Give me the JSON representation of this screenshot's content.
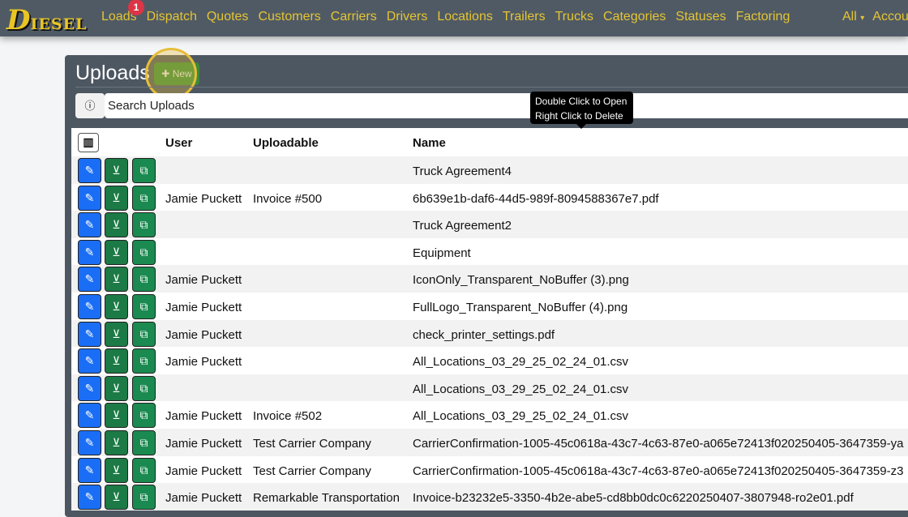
{
  "nav": {
    "logo": "DIESEL",
    "links": [
      "Loads",
      "Dispatch",
      "Quotes",
      "Customers",
      "Carriers",
      "Drivers",
      "Locations",
      "Trailers",
      "Trucks",
      "Categories",
      "Statuses",
      "Factoring"
    ],
    "loads_badge": "1",
    "filter": "All",
    "account": "Account"
  },
  "page": {
    "title": "Uploads",
    "new_label": "New",
    "search_value": "Search Uploads",
    "tooltip_line1": "Double Click to Open",
    "tooltip_line2": "Right Click to Delete"
  },
  "table": {
    "headers": [
      "User",
      "Uploadable",
      "Name"
    ],
    "rows": [
      [
        "",
        "",
        "Truck Agreement4"
      ],
      [
        "Jamie Puckett",
        "Invoice #500",
        "6b639e1b-daf6-44d5-989f-8094588367e7.pdf"
      ],
      [
        "",
        "",
        "Truck Agreement2"
      ],
      [
        "",
        "",
        "Equipment"
      ],
      [
        "Jamie Puckett",
        "",
        "IconOnly_Transparent_NoBuffer (3).png"
      ],
      [
        "Jamie Puckett",
        "",
        "FullLogo_Transparent_NoBuffer (4).png"
      ],
      [
        "Jamie Puckett",
        "",
        "check_printer_settings.pdf"
      ],
      [
        "Jamie Puckett",
        "",
        "All_Locations_03_29_25_02_24_01.csv"
      ],
      [
        "",
        "",
        "All_Locations_03_29_25_02_24_01.csv"
      ],
      [
        "Jamie Puckett",
        "Invoice #502",
        "All_Locations_03_29_25_02_24_01.csv"
      ],
      [
        "Jamie Puckett",
        "Test Carrier Company",
        "CarrierConfirmation-1005-45c0618a-43c7-4c63-87e0-a065e72413f020250405-3647359-ya"
      ],
      [
        "Jamie Puckett",
        "Test Carrier Company",
        "CarrierConfirmation-1005-45c0618a-43c7-4c63-87e0-a065e72413f020250405-3647359-z3"
      ],
      [
        "Jamie Puckett",
        "Remarkable Transportation",
        "Invoice-b23232e5-3350-4b2e-abe5-cd8bb0dc0c6220250407-3807948-ro2e01.pdf"
      ]
    ]
  },
  "colors": {
    "navbar": "#505a65",
    "nav_link": "#e4c533",
    "edit": "#1a6ef5",
    "download": "#1b7a45",
    "new": "#3a8a3a"
  }
}
